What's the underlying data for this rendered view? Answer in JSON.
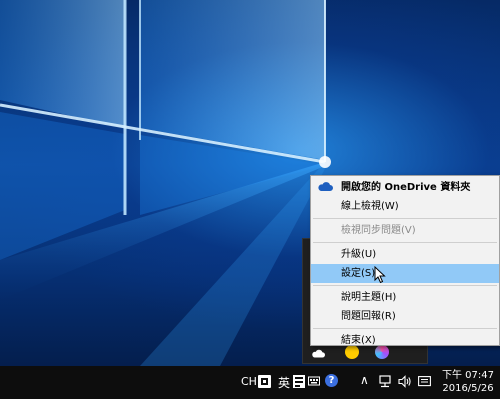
{
  "context_menu": {
    "items": [
      {
        "label": "開啟您的 OneDrive 資料夾"
      },
      {
        "label": "線上檢視(W)"
      },
      {
        "label": "檢視同步問題(V)"
      },
      {
        "label": "升級(U)"
      },
      {
        "label": "設定(S)"
      },
      {
        "label": "說明主題(H)"
      },
      {
        "label": "問題回報(R)"
      },
      {
        "label": "結束(X)"
      }
    ]
  },
  "taskbar": {
    "ime_mode": "CH",
    "ime_language": "英",
    "help_glyph": "?",
    "tray_expand_glyph": "∧",
    "clock": {
      "time": "下午 07:47",
      "date": "2016/5/26"
    }
  },
  "icons": {
    "onedrive": "cloud-icon",
    "network": "network-icon",
    "volume": "speaker-icon",
    "action_center": "message-icon",
    "cursor": "pointer-arrow-icon"
  },
  "colors": {
    "menu_highlight": "#91c9f7",
    "taskbar": "#0d0d0d",
    "onedrive_blue": "#1e5fbf"
  }
}
